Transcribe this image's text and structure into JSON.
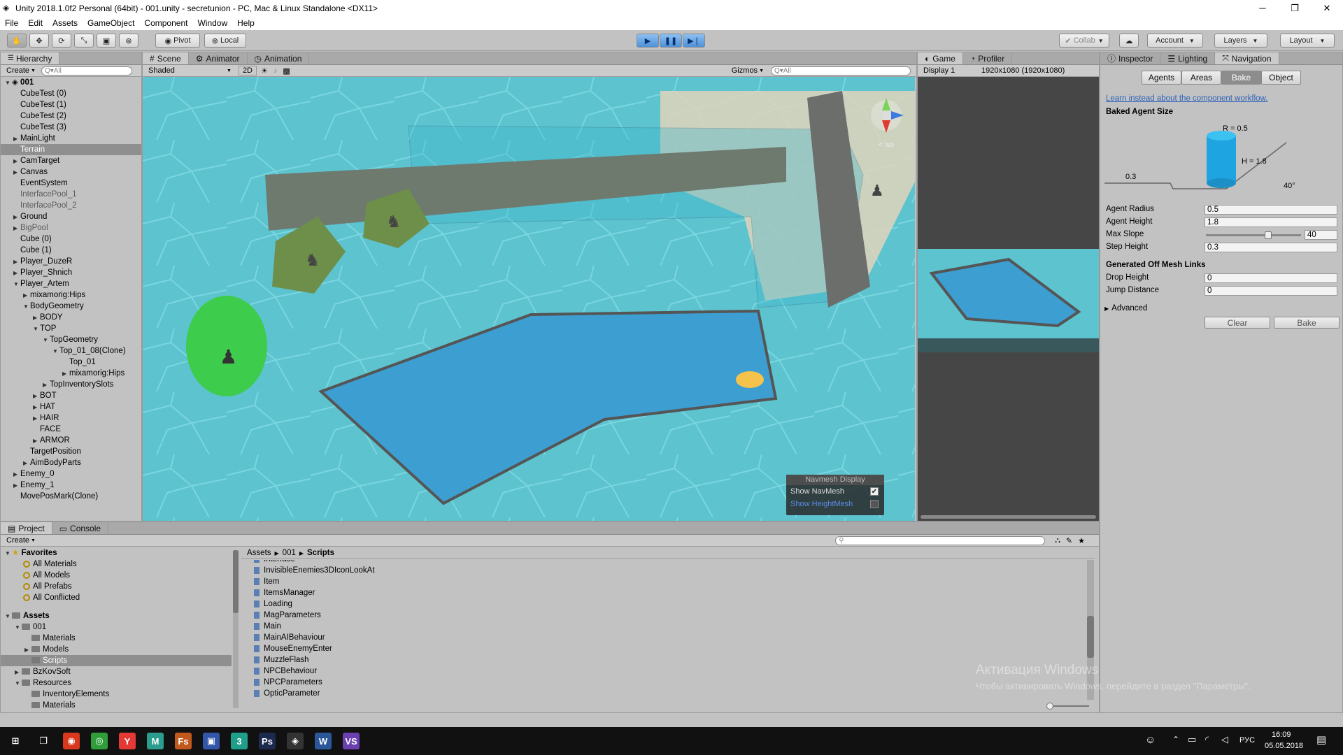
{
  "window": {
    "title": "Unity 2018.1.0f2 Personal (64bit) - 001.unity - secretunion - PC, Mac & Linux Standalone <DX11>",
    "min": "─",
    "max": "❐",
    "close": "✕"
  },
  "menu": [
    "File",
    "Edit",
    "Assets",
    "GameObject",
    "Component",
    "Window",
    "Help"
  ],
  "toolbar": {
    "pivot": "Pivot",
    "local": "Local",
    "collab": "Collab",
    "account": "Account",
    "layers": "Layers",
    "layout": "Layout"
  },
  "hierarchy": {
    "tab": "Hierarchy",
    "create": "Create",
    "search_placeholder": "Q▾All",
    "scene": "001",
    "items": [
      {
        "label": "CubeTest (0)",
        "indent": 0,
        "arrow": "",
        "state": ""
      },
      {
        "label": "CubeTest (1)",
        "indent": 0,
        "arrow": "",
        "state": ""
      },
      {
        "label": "CubeTest (2)",
        "indent": 0,
        "arrow": "",
        "state": ""
      },
      {
        "label": "CubeTest (3)",
        "indent": 0,
        "arrow": "",
        "state": ""
      },
      {
        "label": "MainLight",
        "indent": 0,
        "arrow": "▶",
        "state": ""
      },
      {
        "label": "Terrain",
        "indent": 0,
        "arrow": "",
        "state": "sel"
      },
      {
        "label": "CamTarget",
        "indent": 0,
        "arrow": "▶",
        "state": ""
      },
      {
        "label": "Canvas",
        "indent": 0,
        "arrow": "▶",
        "state": ""
      },
      {
        "label": "EventSystem",
        "indent": 0,
        "arrow": "",
        "state": ""
      },
      {
        "label": "InterfacePool_1",
        "indent": 0,
        "arrow": "",
        "state": "gray"
      },
      {
        "label": "InterfacePool_2",
        "indent": 0,
        "arrow": "",
        "state": "gray"
      },
      {
        "label": "Ground",
        "indent": 0,
        "arrow": "▶",
        "state": ""
      },
      {
        "label": "BigPool",
        "indent": 0,
        "arrow": "▶",
        "state": "gray"
      },
      {
        "label": "Cube (0)",
        "indent": 0,
        "arrow": "",
        "state": ""
      },
      {
        "label": "Cube (1)",
        "indent": 0,
        "arrow": "",
        "state": ""
      },
      {
        "label": "Player_DuzeR",
        "indent": 0,
        "arrow": "▶",
        "state": ""
      },
      {
        "label": "Player_Shnich",
        "indent": 0,
        "arrow": "▶",
        "state": ""
      },
      {
        "label": "Player_Artem",
        "indent": 0,
        "arrow": "▼",
        "state": ""
      },
      {
        "label": "mixamorig:Hips",
        "indent": 1,
        "arrow": "▶",
        "state": ""
      },
      {
        "label": "BodyGeometry",
        "indent": 1,
        "arrow": "▼",
        "state": ""
      },
      {
        "label": "BODY",
        "indent": 2,
        "arrow": "▶",
        "state": ""
      },
      {
        "label": "TOP",
        "indent": 2,
        "arrow": "▼",
        "state": ""
      },
      {
        "label": "TopGeometry",
        "indent": 3,
        "arrow": "▼",
        "state": ""
      },
      {
        "label": "Top_01_08(Clone)",
        "indent": 4,
        "arrow": "▼",
        "state": ""
      },
      {
        "label": "Top_01",
        "indent": 5,
        "arrow": "",
        "state": ""
      },
      {
        "label": "mixamorig:Hips",
        "indent": 5,
        "arrow": "▶",
        "state": ""
      },
      {
        "label": "TopInventorySlots",
        "indent": 3,
        "arrow": "▶",
        "state": ""
      },
      {
        "label": "BOT",
        "indent": 2,
        "arrow": "▶",
        "state": ""
      },
      {
        "label": "HAT",
        "indent": 2,
        "arrow": "▶",
        "state": ""
      },
      {
        "label": "HAIR",
        "indent": 2,
        "arrow": "▶",
        "state": ""
      },
      {
        "label": "FACE",
        "indent": 2,
        "arrow": "",
        "state": ""
      },
      {
        "label": "ARMOR",
        "indent": 2,
        "arrow": "▶",
        "state": ""
      },
      {
        "label": "TargetPosition",
        "indent": 1,
        "arrow": "",
        "state": ""
      },
      {
        "label": "AimBodyParts",
        "indent": 1,
        "arrow": "▶",
        "state": ""
      },
      {
        "label": "Enemy_0",
        "indent": 0,
        "arrow": "▶",
        "state": ""
      },
      {
        "label": "Enemy_1",
        "indent": 0,
        "arrow": "▶",
        "state": ""
      },
      {
        "label": "MovePosMark(Clone)",
        "indent": 0,
        "arrow": "",
        "state": ""
      }
    ]
  },
  "scene": {
    "tabs": [
      "Scene",
      "Animator",
      "Animation"
    ],
    "shaded": "Shaded",
    "mode2d": "2D",
    "gizmos": "Gizmos",
    "search_placeholder": "Q▾All",
    "gizmo_label": "< Iso",
    "navmesh": {
      "title": "Navmesh Display",
      "show_navmesh": "Show NavMesh",
      "show_heightmesh": "Show HeightMesh",
      "navmesh_checked": true
    }
  },
  "game": {
    "tabs": [
      "Game",
      "Profiler"
    ],
    "display": "Display 1",
    "resolution": "1920x1080 (1920x1080)"
  },
  "inspector": {
    "tabs": [
      "Inspector",
      "Lighting",
      "Navigation"
    ],
    "nav_tabs": [
      "Agents",
      "Areas",
      "Bake",
      "Object"
    ],
    "active_nav_tab": "Bake",
    "link": "Learn instead about the component workflow.",
    "baked_title": "Baked Agent Size",
    "diagram": {
      "r": "R = 0.5",
      "h": "H = 1.8",
      "step": "0.3",
      "slope": "40°"
    },
    "fields": [
      {
        "label": "Agent Radius",
        "value": "0.5"
      },
      {
        "label": "Agent Height",
        "value": "1.8"
      }
    ],
    "max_slope": {
      "label": "Max Slope",
      "value": "40",
      "fraction": 0.67
    },
    "step_height": {
      "label": "Step Height",
      "value": "0.3"
    },
    "offmesh_title": "Generated Off Mesh Links",
    "offmesh_fields": [
      {
        "label": "Drop Height",
        "value": "0"
      },
      {
        "label": "Jump Distance",
        "value": "0"
      }
    ],
    "advanced": "Advanced",
    "clear": "Clear",
    "bake": "Bake"
  },
  "project": {
    "tabs": [
      "Project",
      "Console"
    ],
    "create": "Create",
    "favorites_title": "Favorites",
    "favorites": [
      "All Materials",
      "All Models",
      "All Prefabs",
      "All Conflicted"
    ],
    "assets_title": "Assets",
    "tree": [
      {
        "label": "001",
        "indent": 1,
        "arrow": "▼",
        "state": ""
      },
      {
        "label": "Materials",
        "indent": 2,
        "arrow": "",
        "state": ""
      },
      {
        "label": "Models",
        "indent": 2,
        "arrow": "▶",
        "state": ""
      },
      {
        "label": "Scripts",
        "indent": 2,
        "arrow": "",
        "state": "sel"
      },
      {
        "label": "BzKovSoft",
        "indent": 1,
        "arrow": "▶",
        "state": ""
      },
      {
        "label": "Resources",
        "indent": 1,
        "arrow": "▼",
        "state": ""
      },
      {
        "label": "InventoryElements",
        "indent": 2,
        "arrow": "",
        "state": ""
      },
      {
        "label": "Materials",
        "indent": 2,
        "arrow": "",
        "state": ""
      }
    ],
    "breadcrumb": [
      "Assets",
      "001",
      "Scripts"
    ],
    "files": [
      "Interface",
      "InvisibleEnemies3DIconLookAt",
      "Item",
      "ItemsManager",
      "Loading",
      "MagParameters",
      "Main",
      "MainAIBehaviour",
      "MouseEnemyEnter",
      "MuzzleFlash",
      "NPCBehaviour",
      "NPCParameters",
      "OpticParameter"
    ]
  },
  "watermark": {
    "line1": "Активация Windows",
    "line2": "Чтобы активировать Windows, перейдите в раздел \"Параметры\"."
  },
  "taskbar": {
    "apps": [
      {
        "name": "start-icon",
        "glyph": "⊞",
        "color": "#111111"
      },
      {
        "name": "task-view-icon",
        "glyph": "❐",
        "color": "#111111"
      },
      {
        "name": "app-red-icon",
        "glyph": "◉",
        "color": "#d9381e"
      },
      {
        "name": "app-green-icon",
        "glyph": "◎",
        "color": "#2e9d3a"
      },
      {
        "name": "yandex-browser-icon",
        "glyph": "Y",
        "color": "#e53935"
      },
      {
        "name": "app-m-icon",
        "glyph": "M",
        "color": "#2a9d8f"
      },
      {
        "name": "flash-icon",
        "glyph": "Fs",
        "color": "#c0591b"
      },
      {
        "name": "save-app-icon",
        "glyph": "▣",
        "color": "#3256a8"
      },
      {
        "name": "app-3-icon",
        "glyph": "3",
        "color": "#1f9e89"
      },
      {
        "name": "photoshop-icon",
        "glyph": "Ps",
        "color": "#1b2a4e"
      },
      {
        "name": "unity-icon",
        "glyph": "◈",
        "color": "#333333"
      },
      {
        "name": "word-icon",
        "glyph": "W",
        "color": "#2b579a"
      },
      {
        "name": "visual-studio-icon",
        "glyph": "VS",
        "color": "#6a3fb0"
      }
    ],
    "lang": "РУС",
    "time": "16:09",
    "date": "05.05.2018"
  }
}
